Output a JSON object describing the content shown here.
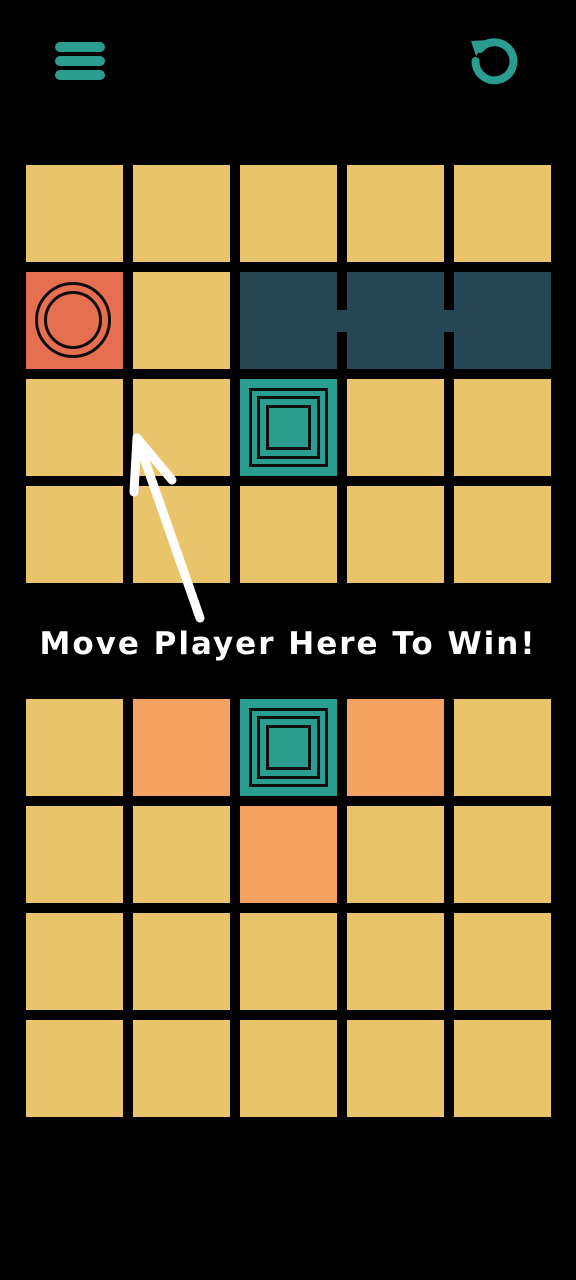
{
  "hint": {
    "text": "Move Player Here To Win!"
  },
  "colors": {
    "background": "#000000",
    "floor": "#e9c46a",
    "wall": "#264653",
    "goal": "#2a9d8f",
    "player": "#e76f51",
    "highlight": "#f4a261",
    "icon": "#2a9d8f",
    "text": "#ffffff"
  },
  "toolbar": {
    "menu_icon": "hamburger-menu-icon",
    "restart_icon": "restart-icon"
  },
  "top_board": {
    "rows": 4,
    "cols": 5,
    "tiles": [
      [
        "floor",
        "floor",
        "floor",
        "floor",
        "floor"
      ],
      [
        "player",
        "floor",
        "wall",
        "wall",
        "wall"
      ],
      [
        "floor",
        "floor",
        "goal",
        "floor",
        "floor"
      ],
      [
        "floor",
        "floor",
        "floor",
        "floor",
        "floor"
      ]
    ]
  },
  "bottom_board": {
    "rows": 4,
    "cols": 5,
    "tiles": [
      [
        "floor",
        "highlight",
        "goal",
        "highlight",
        "floor"
      ],
      [
        "floor",
        "floor",
        "highlight",
        "floor",
        "floor"
      ],
      [
        "floor",
        "floor",
        "floor",
        "floor",
        "floor"
      ],
      [
        "floor",
        "floor",
        "floor",
        "floor",
        "floor"
      ]
    ]
  }
}
